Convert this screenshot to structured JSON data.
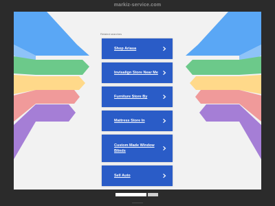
{
  "page": {
    "domain": "markiz-service.com"
  },
  "content": {
    "related_label": "Related searches",
    "links": [
      {
        "label": "Shop Ariaua"
      },
      {
        "label": "Invisalign Store Near Me"
      },
      {
        "label": "Furniture Store By"
      },
      {
        "label": "Mattress Store In"
      },
      {
        "label": "Custom Made Window Blinds"
      },
      {
        "label": "Sell Auto"
      }
    ]
  },
  "search": {
    "placeholder": "",
    "button_label": ""
  },
  "colors": {
    "background": "#2b2b2b",
    "panel": "#f2f2f2",
    "link_card": "#2a5cc7",
    "wing_stripes": [
      "#5aa7f5",
      "#6cc98a",
      "#ffd98a",
      "#f09a9a",
      "#a57ed6"
    ]
  }
}
